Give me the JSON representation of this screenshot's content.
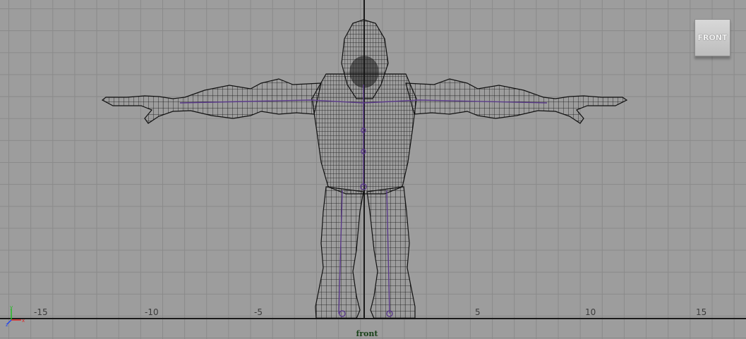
{
  "viewport": {
    "camera_name": "front",
    "view_cube_label": "FRONT"
  },
  "ruler": {
    "ticks": [
      "-15",
      "-10",
      "-5",
      "5",
      "10",
      "15"
    ]
  },
  "gizmo": {
    "axes": [
      "y",
      "z",
      "x"
    ],
    "colors": {
      "y": "#22bb22",
      "z": "#2244ee",
      "x": "#dd2222"
    }
  },
  "model": {
    "wire_color": "#101010",
    "joint_color": "#5a3a8a"
  }
}
